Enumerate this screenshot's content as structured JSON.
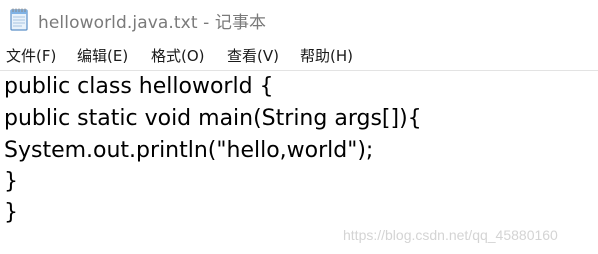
{
  "window": {
    "title": "helloworld.java.txt - 记事本",
    "icon": "notepad-icon"
  },
  "menu": {
    "items": [
      {
        "label": "文件(F)"
      },
      {
        "label": "编辑(E)"
      },
      {
        "label": "格式(O)"
      },
      {
        "label": "查看(V)"
      },
      {
        "label": "帮助(H)"
      }
    ]
  },
  "editor": {
    "lines": [
      "public class helloworld {",
      "public static void main(String args[]){",
      "System.out.println(\"hello,world\");",
      "}",
      "}"
    ]
  },
  "watermark": {
    "text": "https://blog.csdn.net/qq_45880160"
  }
}
